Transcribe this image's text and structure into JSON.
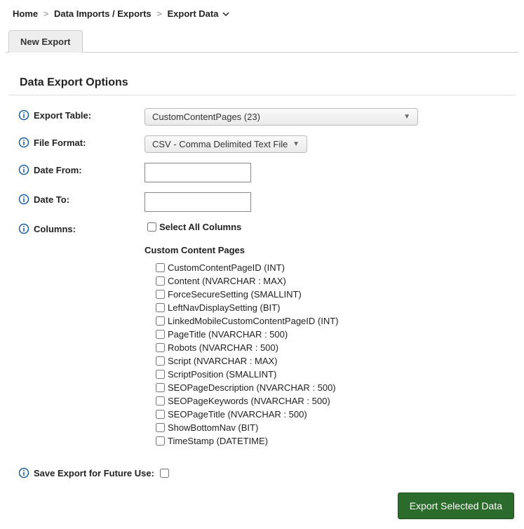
{
  "breadcrumb": {
    "home": "Home",
    "mid": "Data Imports / Exports",
    "last": "Export Data"
  },
  "tab": {
    "label": "New Export"
  },
  "section_title": "Data Export Options",
  "fields": {
    "export_table_label": "Export Table:",
    "file_format_label": "File Format:",
    "date_from_label": "Date From:",
    "date_to_label": "Date To:",
    "columns_label": "Columns:",
    "save_label": "Save Export for Future Use:"
  },
  "values": {
    "export_table": "CustomContentPages (23)",
    "file_format": "CSV - Comma Delimited Text File",
    "date_from": "",
    "date_to": ""
  },
  "select_all_label": "Select All Columns",
  "group_title": "Custom Content Pages",
  "columns": [
    "CustomContentPageID (INT)",
    "Content (NVARCHAR : MAX)",
    "ForceSecureSetting (SMALLINT)",
    "LeftNavDisplaySetting (BIT)",
    "LinkedMobileCustomContentPageID (INT)",
    "PageTitle (NVARCHAR : 500)",
    "Robots (NVARCHAR : 500)",
    "Script (NVARCHAR : MAX)",
    "ScriptPosition (SMALLINT)",
    "SEOPageDescription (NVARCHAR : 500)",
    "SEOPageKeywords (NVARCHAR : 500)",
    "SEOPageTitle (NVARCHAR : 500)",
    "ShowBottomNav (BIT)",
    "TimeStamp (DATETIME)"
  ],
  "export_button": "Export Selected Data"
}
